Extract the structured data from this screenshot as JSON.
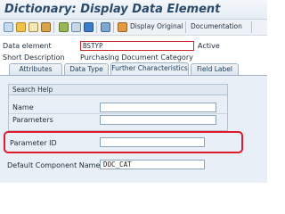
{
  "window": {
    "title": "Dictionary: Display Data Element"
  },
  "toolbar": {
    "display_original_label": "Display Original",
    "documentation_label": "Documentation"
  },
  "header": {
    "data_element_label": "Data element",
    "data_element_value": "BSTYP",
    "status_value": "Active",
    "short_description_label": "Short Description",
    "short_description_value": "Purchasing Document Category"
  },
  "tabs": [
    {
      "label": "Attributes"
    },
    {
      "label": "Data Type"
    },
    {
      "label": "Further Characteristics",
      "active": true
    },
    {
      "label": "Field Label"
    }
  ],
  "search_help": {
    "title": "Search Help",
    "name_label": "Name",
    "name_value": "",
    "parameters_label": "Parameters",
    "parameters_value": ""
  },
  "parameter_id": {
    "label": "Parameter ID",
    "value": ""
  },
  "default_component": {
    "label": "Default Component Name",
    "value": "DOC_CAT"
  },
  "colors": {
    "highlight": "#e01a2a",
    "title": "#2a4a6b",
    "panel": "#e8eff6"
  }
}
